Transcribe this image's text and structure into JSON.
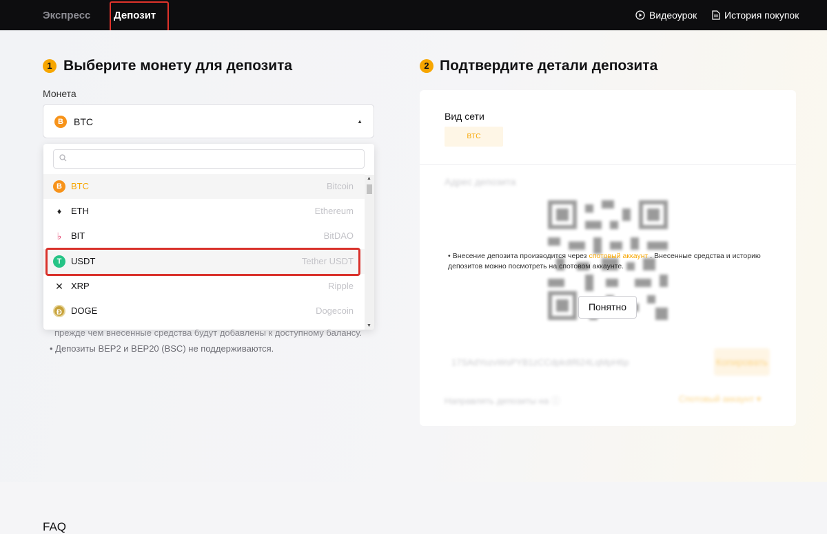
{
  "topbar": {
    "tab_express": "Экспресс",
    "tab_deposit": "Депозит",
    "video_label": "Видеоурок",
    "history_label": "История покупок"
  },
  "step1": {
    "number": "1",
    "title": "Выберите монету для депозита"
  },
  "step2": {
    "number": "2",
    "title": "Подтвердите детали депозита"
  },
  "coin_field": {
    "label": "Монета",
    "selected": "BTC",
    "selected_icon": "B"
  },
  "dropdown": {
    "search_placeholder": "",
    "options": [
      {
        "symbol": "BTC",
        "name": "Bitcoin",
        "icon": "B"
      },
      {
        "symbol": "ETH",
        "name": "Ethereum",
        "icon": "♦"
      },
      {
        "symbol": "BIT",
        "name": "BitDAO",
        "icon": "♭"
      },
      {
        "symbol": "USDT",
        "name": "Tether USDT",
        "icon": "T"
      },
      {
        "symbol": "XRP",
        "name": "Ripple",
        "icon": "✕"
      },
      {
        "symbol": "DOGE",
        "name": "Dogecoin",
        "icon": "Ð"
      }
    ]
  },
  "notes": {
    "line1": "прежде чем внесенные средства будут добавлены к доступному балансу.",
    "line2": "• Депозиты BEP2 и BEP20 (BSC) не поддерживаются."
  },
  "card": {
    "network_label": "Вид сети",
    "network_value": "BTC",
    "address_label": "Адрес депозита",
    "address_value": "17SAdYozvWsPYB1zCCdpkdtf624LqMpH6p",
    "copy_label": "Копировать",
    "direct_label": "Направлять депозиты на ⓘ",
    "direct_value": "Спотовый аккаунт ▾",
    "info_bullet": "•",
    "info_before": "Внесение депозита производится через ",
    "info_link": "спотовый аккаунт",
    "info_after": " . Внесенные средства и историю депозитов можно посмотреть на спотовом аккаунте.",
    "ok_label": "Понятно"
  },
  "footer": {
    "faq": "FAQ"
  },
  "colors": {
    "accent": "#f7a600",
    "highlight_box": "#d9312b",
    "topbar": "#0d0d0f"
  }
}
